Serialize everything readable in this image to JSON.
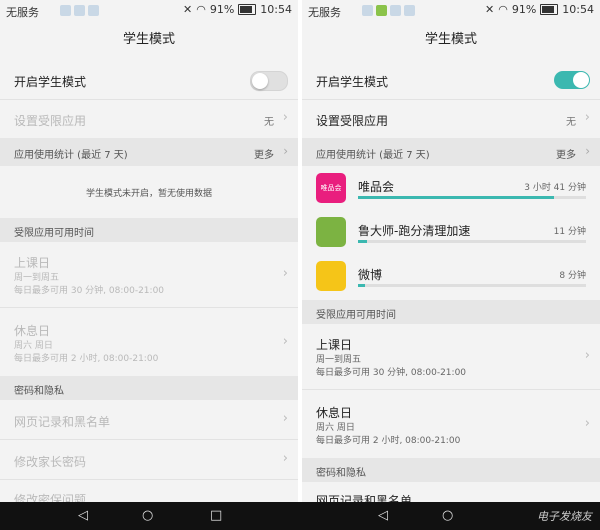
{
  "left": {
    "status": {
      "carrier": "无服务",
      "battery": "91%",
      "time": "10:54"
    },
    "title": "学生模式",
    "toggle_label": "开启学生模式",
    "toggle_state": "off",
    "restricted_apps_label": "设置受限应用",
    "restricted_apps_value": "无",
    "usage_header": "应用使用统计 (最近 7 天)",
    "usage_more": "更多",
    "no_data_text": "学生模式未开启，暂无使用数据",
    "time_section": "受限应用可用时间",
    "school_day": {
      "title": "上课日",
      "line1": "周一到周五",
      "line2": "每日最多可用 30 分钟, 08:00-21:00"
    },
    "rest_day": {
      "title": "休息日",
      "line1": "周六 周日",
      "line2": "每日最多可用 2 小时, 08:00-21:00"
    },
    "privacy_section": "密码和隐私",
    "web_history": "网页记录和黑名单",
    "change_password": "修改家长密码",
    "security_question": "修改密保问题"
  },
  "right": {
    "status": {
      "carrier": "无服务",
      "battery": "91%",
      "time": "10:54"
    },
    "title": "学生模式",
    "toggle_label": "开启学生模式",
    "toggle_state": "on",
    "restricted_apps_label": "设置受限应用",
    "restricted_apps_value": "无",
    "usage_header": "应用使用统计 (最近 7 天)",
    "usage_more": "更多",
    "apps": [
      {
        "name": "唯品会",
        "time": "3 小时 41 分钟",
        "usage_fraction": 0.86,
        "icon": "vipshop-icon",
        "icon_color": "#e91e7e",
        "icon_text": "唯品会"
      },
      {
        "name": "鲁大师-跑分清理加速",
        "time": "11 分钟",
        "usage_fraction": 0.04,
        "icon": "ludashi-icon",
        "icon_color": "#4caf50",
        "icon_text": ""
      },
      {
        "name": "微博",
        "time": "8 分钟",
        "usage_fraction": 0.03,
        "icon": "weibo-icon",
        "icon_color": "#f5c518",
        "icon_text": ""
      }
    ],
    "time_section": "受限应用可用时间",
    "school_day": {
      "title": "上课日",
      "line1": "周一到周五",
      "line2": "每日最多可用 30 分钟, 08:00-21:00"
    },
    "rest_day": {
      "title": "休息日",
      "line1": "周六 周日",
      "line2": "每日最多可用 2 小时, 08:00-21:00"
    },
    "privacy_section": "密码和隐私",
    "web_history": "网页记录和黑名单"
  },
  "navbar": {
    "back": "◁",
    "home": "○",
    "recent": "□",
    "watermark": "电子发烧友"
  },
  "colors": {
    "accent": "#3bb8b0",
    "section_bg": "#e6e6e6",
    "page_bg": "#f3f3f3"
  }
}
